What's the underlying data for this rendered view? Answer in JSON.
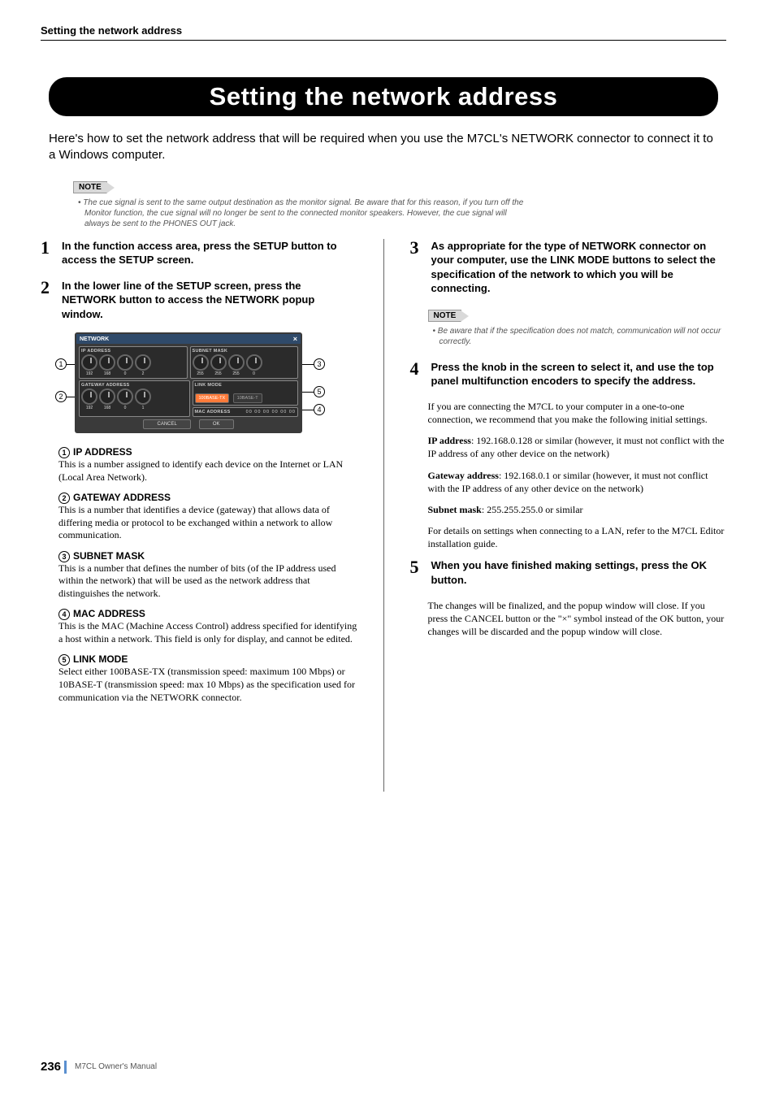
{
  "header": {
    "running_title": "Setting the network address"
  },
  "main_title": "Setting the network address",
  "intro": "Here's how to set the network address that will be required when you use the M7CL's NETWORK connector to connect it to a Windows computer.",
  "note_tab": "NOTE",
  "top_note": "The cue signal is sent to the same output destination as the monitor signal. Be aware that for this reason, if you turn off the Monitor function, the cue signal will no longer be sent to the connected monitor speakers. However, the cue signal will always be sent to the PHONES OUT jack.",
  "steps": {
    "s1": "In the function access area, press the SETUP button to access the SETUP screen.",
    "s2": "In the lower line of the SETUP screen, press the NETWORK button to access the NETWORK popup window.",
    "s3": "As appropriate for the type of NETWORK connector on your computer, use the LINK MODE buttons to select the specification of the network to which you will be connecting.",
    "s4": "Press the knob in the screen to select it, and use the top panel multifunction encoders to specify the address.",
    "s5": "When you have finished making settings, press the OK button."
  },
  "right_note": "Be aware that if the specification does not match, communication will not occur correctly.",
  "body": {
    "b4a": "If you are connecting the M7CL to your computer in a one-to-one connection, we recommend that you make the following initial settings.",
    "b4b_strong": "IP address",
    "b4b": ": 192.168.0.128 or similar (however, it must not conflict with the IP address of any other device on the network)",
    "b4c_strong": "Gateway address",
    "b4c": ": 192.168.0.1 or similar (however, it must not conflict with the IP address of any other device on the network)",
    "b4d_strong": "Subnet mask",
    "b4d": ": 255.255.255.0 or similar",
    "b4e": "For details on settings when connecting to a LAN, refer to the M7CL Editor installation guide.",
    "b5": "The changes will be finalized, and the popup window will close. If you press the CANCEL button or the \"×\" symbol instead of the OK button, your changes will be discarded and the popup window will close."
  },
  "defs": {
    "d1_title": "IP ADDRESS",
    "d1_text": "This is a number assigned to identify each device on the Internet or LAN (Local Area Network).",
    "d2_title": "GATEWAY ADDRESS",
    "d2_text": "This is a number that identifies a device (gateway) that allows data of differing media or protocol to be exchanged within a network to allow communication.",
    "d3_title": "SUBNET MASK",
    "d3_text": "This is a number that defines the number of bits (of the IP address used within the network) that will be used as the network address that distinguishes the network.",
    "d4_title": "MAC ADDRESS",
    "d4_text": "This is the MAC (Machine Access Control) address specified for identifying a host within a network. This field is only for display, and cannot be edited.",
    "d5_title": "LINK MODE",
    "d5_text": "Select either 100BASE-TX (transmission speed: maximum 100 Mbps) or 10BASE-T (transmission speed: max 10 Mbps) as the specification used for communication via the NETWORK connector."
  },
  "ui": {
    "window_title": "NETWORK",
    "ip_label": "IP ADDRESS",
    "subnet_label": "SUBNET MASK",
    "gateway_label": "GATEWAY ADDRESS",
    "link_label": "LINK MODE",
    "mac_label": "MAC ADDRESS",
    "ip_vals": [
      "192",
      "168",
      "0",
      "2"
    ],
    "subnet_vals": [
      "255",
      "255",
      "255",
      "0"
    ],
    "gateway_vals": [
      "192",
      "168",
      "0",
      "1"
    ],
    "link_100": "100BASE-TX",
    "link_10": "10BASE-T",
    "mac_val": "00 00 00 00 00 00",
    "cancel": "CANCEL",
    "ok": "OK"
  },
  "footer": {
    "page": "236",
    "manual": "M7CL  Owner's Manual"
  }
}
